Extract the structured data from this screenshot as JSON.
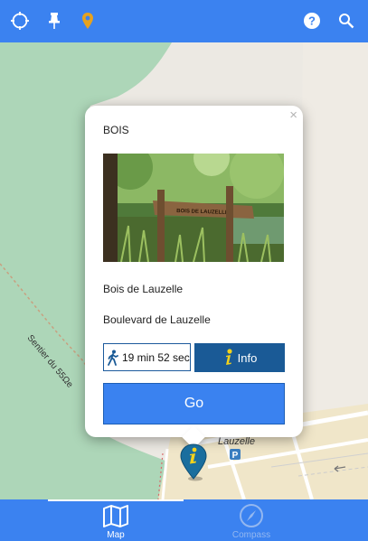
{
  "toolbar": {
    "icons": [
      "locate-icon",
      "pin-icon",
      "location-marker-icon",
      "help-icon",
      "search-icon"
    ]
  },
  "map": {
    "labels": {
      "path": "Sentier du 55Ωe",
      "place": "Lauzelle",
      "parking": "P"
    }
  },
  "popup": {
    "close": "×",
    "title": "BOIS",
    "photo_sign_text": "BOIS DE LAUZELLE",
    "place": "Bois de Lauzelle",
    "street": "Boulevard de Lauzelle",
    "walk_time": "19 min 52 sec",
    "info_label": "Info",
    "go_label": "Go"
  },
  "bottom_nav": {
    "tabs": [
      {
        "label": "Map",
        "icon": "map-icon",
        "active": true
      },
      {
        "label": "Compass",
        "icon": "compass-icon",
        "active": false
      }
    ]
  },
  "colors": {
    "bar": "#3b82f0",
    "info_button": "#1a5a96",
    "go_button": "#3a82f0",
    "forest": "#a8d4b4",
    "marker": "#1a6e9e",
    "marker_glyph": "#f3d21b"
  }
}
